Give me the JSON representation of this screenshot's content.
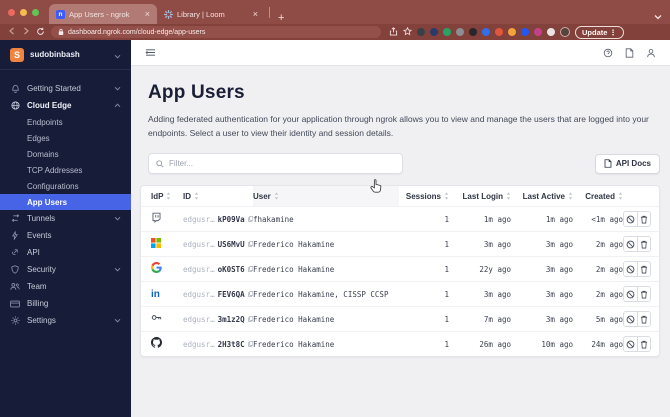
{
  "colors": {
    "accent": "#4763e6",
    "sidebar_bg": "#171c38",
    "chrome_bg": "#8f4c47",
    "ngrok_favicon": "#3b5bfd",
    "active_tab": "#b27a74"
  },
  "browser": {
    "tabs": [
      {
        "title": "App Users - ngrok"
      },
      {
        "title": "Library | Loom"
      }
    ],
    "url": "dashboard.ngrok.com/cloud-edge/app-users",
    "update_label": "Update"
  },
  "sidebar": {
    "account": "sudobinbash",
    "items": [
      {
        "label": "Getting Started"
      },
      {
        "label": "Cloud Edge"
      },
      {
        "label": "Endpoints"
      },
      {
        "label": "Edges"
      },
      {
        "label": "Domains"
      },
      {
        "label": "TCP Addresses"
      },
      {
        "label": "Configurations"
      },
      {
        "label": "App Users"
      },
      {
        "label": "Tunnels"
      },
      {
        "label": "Events"
      },
      {
        "label": "API"
      },
      {
        "label": "Security"
      },
      {
        "label": "Team"
      },
      {
        "label": "Billing"
      },
      {
        "label": "Settings"
      }
    ]
  },
  "page": {
    "title": "App Users",
    "description": "Adding federated authentication for your application through ngrok allows you to view and manage the users that are logged into your endpoints. Select a user to view their identity and session details.",
    "filter_placeholder": "Filter...",
    "api_docs_label": "API Docs"
  },
  "table": {
    "columns": [
      "IdP",
      "ID",
      "User",
      "Sessions",
      "Last Login",
      "Last Active",
      "Created"
    ],
    "rows": [
      {
        "idp": "twitch",
        "id_prefix": "edgusr…",
        "id_suffix": "kP09Va",
        "user": "fhakamine",
        "sessions": "1",
        "last_login": "1m ago",
        "last_active": "1m ago",
        "created": "<1m ago"
      },
      {
        "idp": "microsoft",
        "id_prefix": "edgusr…",
        "id_suffix": "US6MvU",
        "user": "Frederico Hakamine",
        "sessions": "1",
        "last_login": "3m ago",
        "last_active": "3m ago",
        "created": "2m ago"
      },
      {
        "idp": "google",
        "id_prefix": "edgusr…",
        "id_suffix": "oK0ST6",
        "user": "Frederico Hakamine",
        "sessions": "1",
        "last_login": "22y ago",
        "last_active": "3m ago",
        "created": "2m ago"
      },
      {
        "idp": "linkedin",
        "id_prefix": "edgusr…",
        "id_suffix": "FEV6QA",
        "user": "Frederico Hakamine, CISSP CCSP",
        "sessions": "1",
        "last_login": "3m ago",
        "last_active": "3m ago",
        "created": "2m ago"
      },
      {
        "idp": "oidc-key",
        "id_prefix": "edgusr…",
        "id_suffix": "3m1z2Q",
        "user": "Frederico Hakamine",
        "sessions": "1",
        "last_login": "7m ago",
        "last_active": "3m ago",
        "created": "5m ago"
      },
      {
        "idp": "github",
        "id_prefix": "edgusr…",
        "id_suffix": "2H3t8C",
        "user": "Frederico Hakamine",
        "sessions": "1",
        "last_login": "26m ago",
        "last_active": "10m ago",
        "created": "24m ago"
      }
    ]
  }
}
